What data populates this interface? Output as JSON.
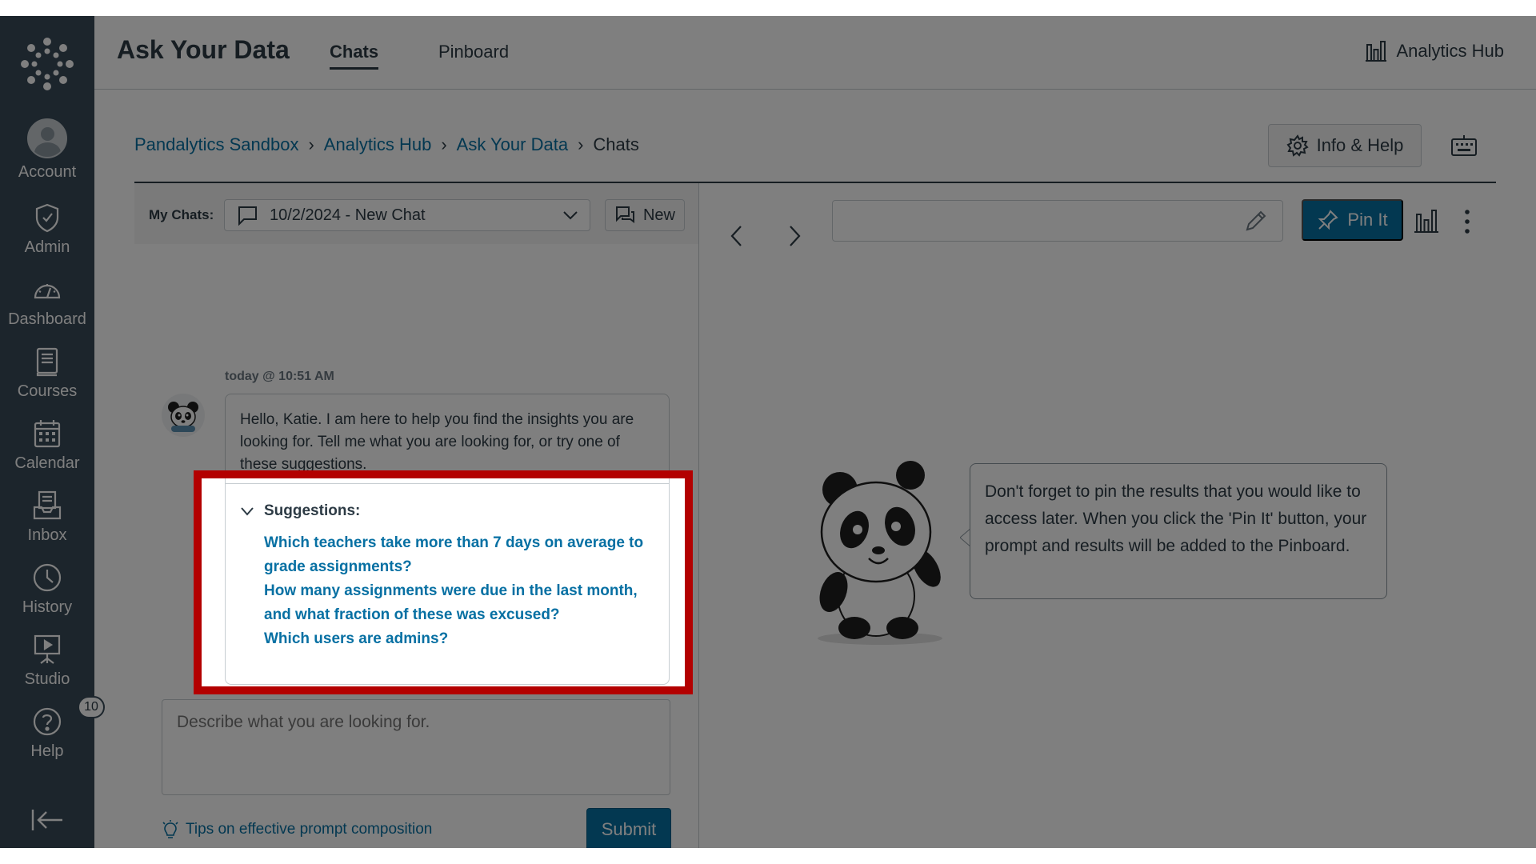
{
  "nav": {
    "items": [
      {
        "label": "Account",
        "icon": "avatar"
      },
      {
        "label": "Admin",
        "icon": "shield-icon"
      },
      {
        "label": "Dashboard",
        "icon": "dashboard-icon"
      },
      {
        "label": "Courses",
        "icon": "book-icon"
      },
      {
        "label": "Calendar",
        "icon": "calendar-icon"
      },
      {
        "label": "Inbox",
        "icon": "inbox-icon"
      },
      {
        "label": "History",
        "icon": "clock-icon"
      },
      {
        "label": "Studio",
        "icon": "studio-icon"
      },
      {
        "label": "Help",
        "icon": "help-icon",
        "badge": "10"
      }
    ]
  },
  "header": {
    "title": "Ask Your Data",
    "tabs": [
      {
        "label": "Chats",
        "active": true
      },
      {
        "label": "Pinboard",
        "active": false
      }
    ],
    "hub_link": "Analytics Hub"
  },
  "breadcrumb": {
    "items": [
      "Pandalytics Sandbox",
      "Analytics Hub",
      "Ask Your Data"
    ],
    "current": "Chats"
  },
  "info_help": "Info & Help",
  "chats_bar": {
    "label": "My Chats:",
    "selected": "10/2/2024 - New Chat",
    "new_label": "New"
  },
  "message": {
    "timestamp": "today @ 10:51 AM",
    "text": "Hello, Katie. I am here to help you find the insights you are looking for. Tell me what you are looking for, or try one of these suggestions.",
    "suggestions_label": "Suggestions:",
    "suggestions": [
      "Which teachers take more than 7 days on average to grade assignments?",
      "How many assignments were due in the last month, and what fraction of these was excused?",
      "Which users are admins?"
    ]
  },
  "prompt": {
    "placeholder": "Describe what you are looking for.",
    "tips": "Tips on effective prompt composition",
    "submit": "Submit"
  },
  "right": {
    "pin_label": "Pin It",
    "tip_text": "Don't forget to pin the results that you would like to access later. When you click the 'Pin It' button, your prompt and results will be added to the Pinboard."
  },
  "colors": {
    "nav_bg": "#394b58",
    "link": "#0770a3",
    "highlight": "#b30000"
  }
}
